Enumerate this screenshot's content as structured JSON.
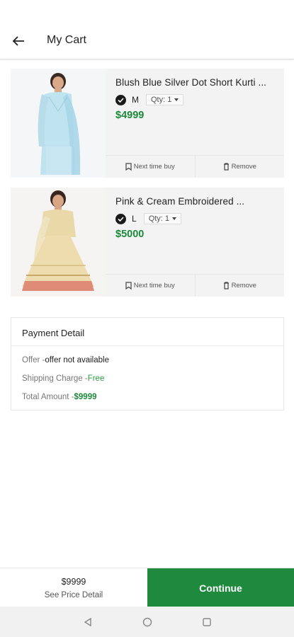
{
  "header": {
    "title": "My Cart"
  },
  "cart": [
    {
      "name": "Blush Blue Silver Dot Short Kurti ...",
      "size": "M",
      "qty": "Qty: 1",
      "price": "$4999",
      "next_label": "Next time buy",
      "remove_label": "Remove"
    },
    {
      "name": "Pink & Cream Embroidered ...",
      "size": "L",
      "qty": "Qty: 1",
      "price": "$5000",
      "next_label": "Next time buy",
      "remove_label": "Remove"
    }
  ],
  "payment": {
    "title": "Payment Detail",
    "offer_label": "Offer -",
    "offer_value": "offer not available",
    "shipping_label": "Shipping Charge -",
    "shipping_value": "Free",
    "total_label": "Total Amount -",
    "total_value": "$9999"
  },
  "footer": {
    "total": "$9999",
    "see_price": "See Price Detail",
    "continue": "Continue"
  },
  "colors": {
    "accent": "#1f8a3e",
    "price": "#1a8a3a"
  },
  "icons": {
    "back": "arrow-left-icon",
    "check": "check-circle-icon",
    "bookmark": "bookmark-icon",
    "trash": "trash-icon"
  }
}
